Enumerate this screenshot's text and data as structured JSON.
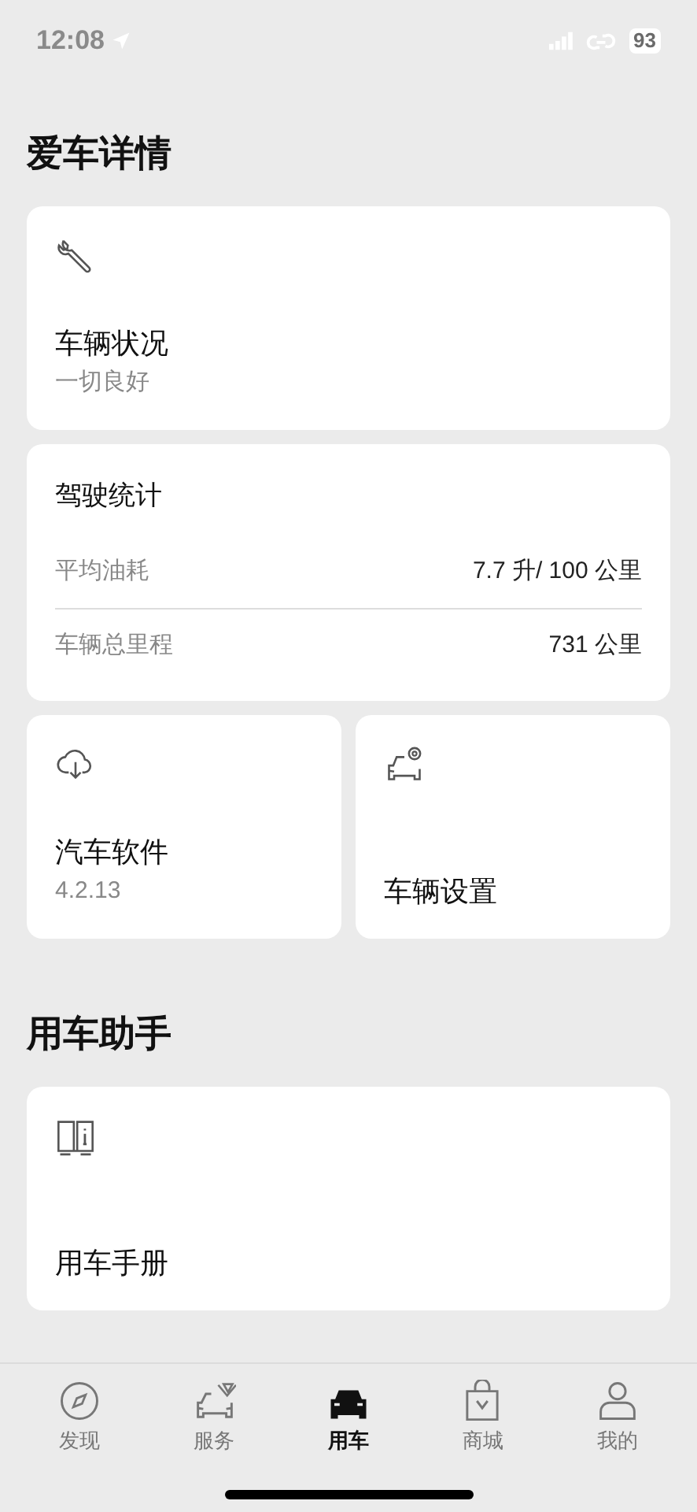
{
  "status_bar": {
    "time": "12:08",
    "battery": "93"
  },
  "sections": [
    {
      "title": "爱车详情",
      "cards": [
        {
          "kind": "status",
          "title": "车辆状况",
          "subtitle": "一切良好"
        },
        {
          "kind": "stats",
          "title": "驾驶统计",
          "rows": [
            {
              "label": "平均油耗",
              "value": "7.7 升/ 100 公里"
            },
            {
              "label": "车辆总里程",
              "value": "731 公里"
            }
          ]
        },
        {
          "kind": "pair",
          "items": [
            {
              "title": "汽车软件",
              "subtitle": "4.2.13"
            },
            {
              "title": "车辆设置"
            }
          ]
        }
      ]
    },
    {
      "title": "用车助手",
      "cards": [
        {
          "kind": "status",
          "title": "用车手册"
        }
      ]
    }
  ],
  "tab_bar": [
    {
      "label": "发现",
      "selected": false
    },
    {
      "label": "服务",
      "selected": false
    },
    {
      "label": "用车",
      "selected": true
    },
    {
      "label": "商城",
      "selected": false
    },
    {
      "label": "我的",
      "selected": false
    }
  ]
}
